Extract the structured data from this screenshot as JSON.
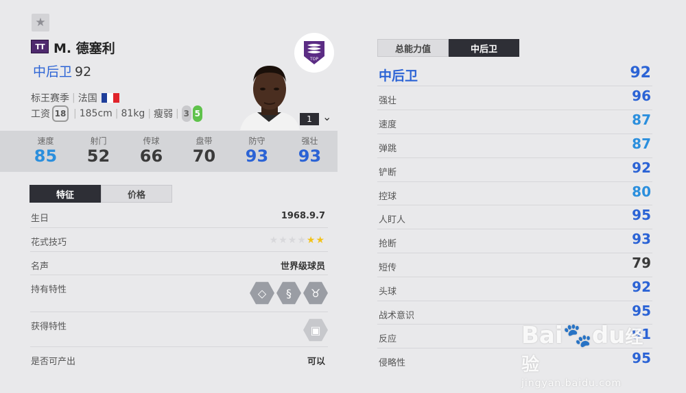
{
  "player": {
    "badge": "TT",
    "name": "M. 德塞利",
    "position": "中后卫",
    "position_rating": "92",
    "season": "标王赛季",
    "nation": "法国",
    "wage_label": "工资",
    "wage": "18",
    "height": "185cm",
    "weight": "81kg",
    "body_type": "瘦弱",
    "weak_foot": "3",
    "skill_level": "5",
    "level": "1"
  },
  "club_logo_text": "TOP",
  "flag_colors": [
    "#1f3f9b",
    "#ffffff",
    "#e0242b"
  ],
  "stats": [
    {
      "label": "速度",
      "value": "85",
      "color": "#2b8fdd"
    },
    {
      "label": "射门",
      "value": "52",
      "color": "#3a3a3a"
    },
    {
      "label": "传球",
      "value": "66",
      "color": "#3a3a3a"
    },
    {
      "label": "盘带",
      "value": "70",
      "color": "#3a3a3a"
    },
    {
      "label": "防守",
      "value": "93",
      "color": "#2b63d5"
    },
    {
      "label": "强壮",
      "value": "93",
      "color": "#2b63d5"
    }
  ],
  "left_tabs": [
    "特征",
    "价格"
  ],
  "features": {
    "birthday_label": "生日",
    "birthday": "1968.9.7",
    "skill_label": "花式技巧",
    "skill_stars_total": 6,
    "skill_stars_filled": 2,
    "fame_label": "名声",
    "fame": "世界级球员",
    "traits_label": "持有特性",
    "traits": [
      "diamond-icon",
      "snake-icon",
      "bull-icon"
    ],
    "gained_label": "获得特性",
    "output_label": "是否可产出",
    "output": "可以"
  },
  "right_tabs": [
    "总能力值",
    "中后卫"
  ],
  "right_header": {
    "label": "中后卫",
    "value": "92"
  },
  "attributes": [
    {
      "label": "强壮",
      "value": "96",
      "color": "#2b63d5"
    },
    {
      "label": "速度",
      "value": "87",
      "color": "#2b8fdd"
    },
    {
      "label": "弹跳",
      "value": "87",
      "color": "#2b8fdd"
    },
    {
      "label": "铲断",
      "value": "92",
      "color": "#2b63d5"
    },
    {
      "label": "控球",
      "value": "80",
      "color": "#2b8fdd"
    },
    {
      "label": "人盯人",
      "value": "95",
      "color": "#2b63d5"
    },
    {
      "label": "抢断",
      "value": "93",
      "color": "#2b63d5"
    },
    {
      "label": "短传",
      "value": "79",
      "color": "#3a3a3a"
    },
    {
      "label": "头球",
      "value": "92",
      "color": "#2b63d5"
    },
    {
      "label": "战术意识",
      "value": "95",
      "color": "#2b63d5"
    },
    {
      "label": "反应",
      "value": "91",
      "color": "#2b63d5"
    },
    {
      "label": "侵略性",
      "value": "95",
      "color": "#2b63d5"
    }
  ],
  "watermark": {
    "brand": "Bai",
    "brand2": "du",
    "cn": "经验",
    "url": "jingyan.baidu.com"
  }
}
